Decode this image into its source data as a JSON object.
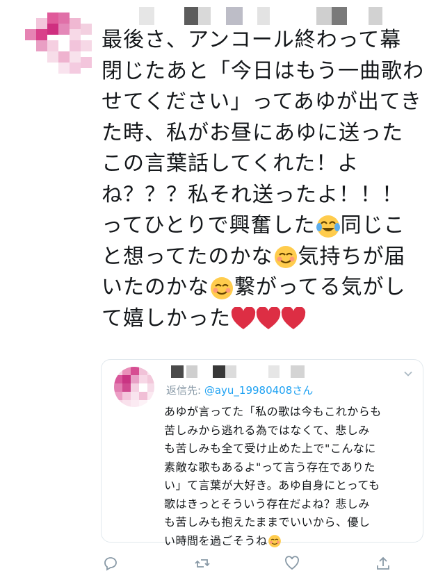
{
  "tweet": {
    "lines": [
      "最後さ、アンコール終わって幕",
      "閉じたあと「今日はもう一曲歌わ",
      "せてください」ってあゆが出てき",
      "た時、私がお昼にあゆに送った",
      "この言葉話してくれた！よ",
      "ね？？？私それ送ったよ！！！",
      "ってひとりで興奮した",
      "同じこ",
      "と想ってたのかな",
      "気持ちが届",
      "いたのかな",
      "繋がってる気がし",
      "て嬉しかった"
    ],
    "emoji": {
      "laugh": "face-with-tears-of-joy-icon",
      "smile": "smiling-face-icon",
      "heart": "red-heart-icon"
    }
  },
  "quote": {
    "reply_prefix": "返信先: ",
    "reply_handle": "@ayu_19980408さん",
    "lines": [
      "あゆが言ってた「私の歌は今もこれからも",
      "苦しみから逃れる為ではなくて、悲しみ",
      "も苦しみも全て受け止めた上で\"こんなに",
      "素敵な歌もあるよ\"って言う存在でありた",
      "い」て言葉が大好き。あゆ自身にとっても",
      "歌はきっとそういう存在だよね？悲しみ",
      "も苦しみも抱えたままでいいから、優し",
      "い時間を過ごそうね"
    ]
  },
  "colors": {
    "text": "#14171a",
    "muted": "#8899a6",
    "link": "#1da1f2",
    "heart": "#e0245e",
    "border": "#e1e8ed"
  }
}
